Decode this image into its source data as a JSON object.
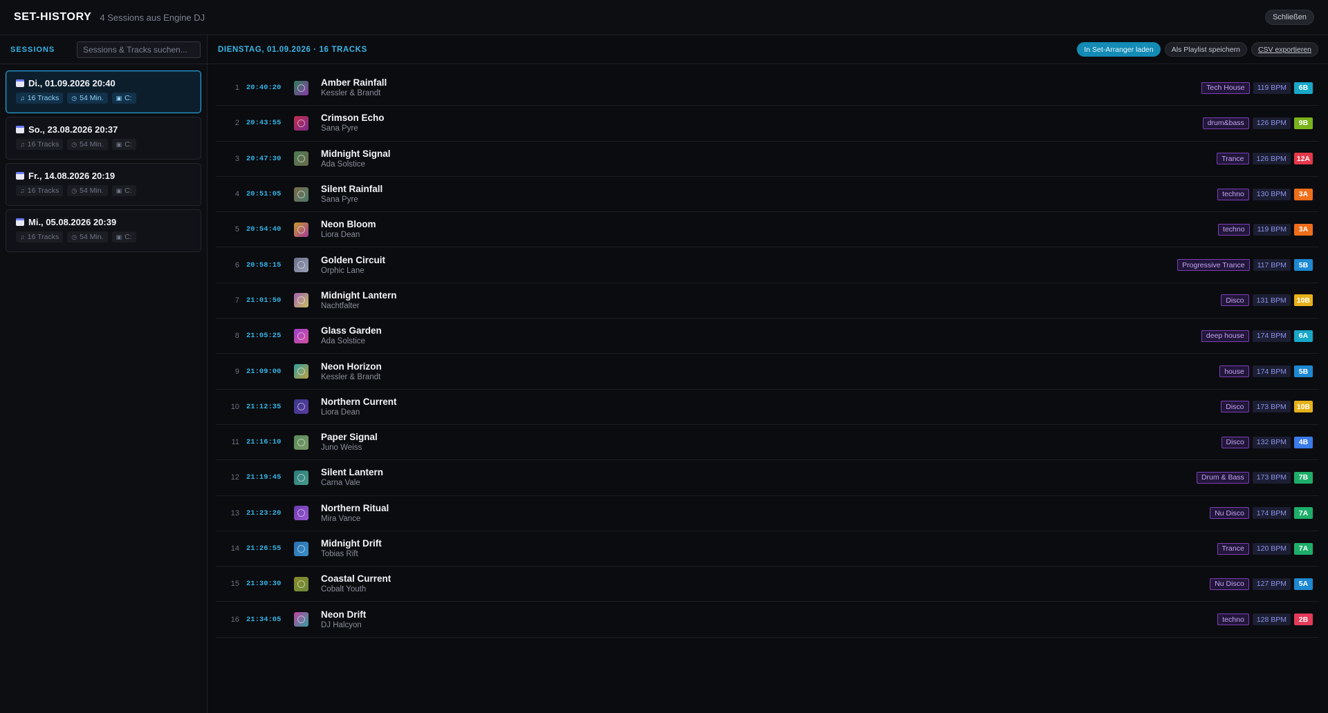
{
  "header": {
    "title": "SET-HISTORY",
    "subtitle": "4 Sessions aus Engine DJ",
    "close_label": "Schließen"
  },
  "sidebar": {
    "label": "SESSIONS",
    "search_placeholder": "Sessions & Tracks suchen...",
    "sessions": [
      {
        "title": "Di., 01.09.2026 20:40",
        "tracks": "16 Tracks",
        "duration": "54 Min.",
        "drive": "C:",
        "active": true
      },
      {
        "title": "So., 23.08.2026 20:37",
        "tracks": "16 Tracks",
        "duration": "54 Min.",
        "drive": "C:",
        "active": false
      },
      {
        "title": "Fr., 14.08.2026 20:19",
        "tracks": "16 Tracks",
        "duration": "54 Min.",
        "drive": "C:",
        "active": false
      },
      {
        "title": "Mi., 05.08.2026 20:39",
        "tracks": "16 Tracks",
        "duration": "54 Min.",
        "drive": "C:",
        "active": false
      }
    ]
  },
  "main": {
    "title": "DIENSTAG, 01.09.2026 · 16 TRACKS",
    "actions": {
      "load_arranger": "In Set-Arranger laden",
      "save_playlist": "Als Playlist speichern",
      "export_csv": "CSV exportieren"
    },
    "tracks": [
      {
        "num": "1",
        "time": "20:40:20",
        "title": "Amber Rainfall",
        "artist": "Kessler & Brandt",
        "genre": "Tech House",
        "bpm": "119 BPM",
        "key": "6B",
        "key_color": "#18a7c9",
        "art": [
          "#2e7d5c",
          "#8a3aa8"
        ]
      },
      {
        "num": "2",
        "time": "20:43:55",
        "title": "Crimson Echo",
        "artist": "Sana Pyre",
        "genre": "drum&bass",
        "bpm": "126 BPM",
        "key": "9B",
        "key_color": "#7ab21c",
        "art": [
          "#c22d4a",
          "#7a2a8c"
        ]
      },
      {
        "num": "3",
        "time": "20:47:30",
        "title": "Midnight Signal",
        "artist": "Ada Solstice",
        "genre": "Trance",
        "bpm": "126 BPM",
        "key": "12A",
        "key_color": "#e5384a",
        "art": [
          "#4a7a52",
          "#6a6a4a"
        ]
      },
      {
        "num": "4",
        "time": "20:51:05",
        "title": "Silent Rainfall",
        "artist": "Sana Pyre",
        "genre": "techno",
        "bpm": "130 BPM",
        "key": "3A",
        "key_color": "#ef6e1a",
        "art": [
          "#7a6a4a",
          "#4a7a6a"
        ]
      },
      {
        "num": "5",
        "time": "20:54:40",
        "title": "Neon Bloom",
        "artist": "Liora Dean",
        "genre": "techno",
        "bpm": "119 BPM",
        "key": "3A",
        "key_color": "#ef6e1a",
        "art": [
          "#c79b2a",
          "#a03a9a"
        ]
      },
      {
        "num": "6",
        "time": "20:58:15",
        "title": "Golden Circuit",
        "artist": "Orphic Lane",
        "genre": "Progressive Trance",
        "bpm": "117 BPM",
        "key": "5B",
        "key_color": "#1e88d2",
        "art": [
          "#6a6f8a",
          "#9aa0b5"
        ]
      },
      {
        "num": "7",
        "time": "21:01:50",
        "title": "Midnight Lantern",
        "artist": "Nachtfalter",
        "genre": "Disco",
        "bpm": "131 BPM",
        "key": "10B",
        "key_color": "#e6b21a",
        "art": [
          "#a060b0",
          "#c8c060"
        ]
      },
      {
        "num": "8",
        "time": "21:05:25",
        "title": "Glass Garden",
        "artist": "Ada Solstice",
        "genre": "deep house",
        "bpm": "174 BPM",
        "key": "6A",
        "key_color": "#18a7c9",
        "art": [
          "#a040c8",
          "#d050a0"
        ]
      },
      {
        "num": "9",
        "time": "21:09:00",
        "title": "Neon Horizon",
        "artist": "Kessler & Brandt",
        "genre": "house",
        "bpm": "174 BPM",
        "key": "5B",
        "key_color": "#1e88d2",
        "art": [
          "#30a0a0",
          "#c0a040"
        ]
      },
      {
        "num": "10",
        "time": "21:12:35",
        "title": "Northern Current",
        "artist": "Liora Dean",
        "genre": "Disco",
        "bpm": "173 BPM",
        "key": "10B",
        "key_color": "#e6b21a",
        "art": [
          "#3a3a8a",
          "#5a3aa0"
        ]
      },
      {
        "num": "11",
        "time": "21:16:10",
        "title": "Paper Signal",
        "artist": "Juno Weiss",
        "genre": "Disco",
        "bpm": "132 BPM",
        "key": "4B",
        "key_color": "#3a7be8",
        "art": [
          "#5a8a5a",
          "#7a9a6a"
        ]
      },
      {
        "num": "12",
        "time": "21:19:45",
        "title": "Silent Lantern",
        "artist": "Carna Vale",
        "genre": "Drum & Bass",
        "bpm": "173 BPM",
        "key": "7B",
        "key_color": "#1eae6a",
        "art": [
          "#2a7a7a",
          "#4a9a8a"
        ]
      },
      {
        "num": "13",
        "time": "21:23:20",
        "title": "Northern Ritual",
        "artist": "Mira Vance",
        "genre": "Nu Disco",
        "bpm": "174 BPM",
        "key": "7A",
        "key_color": "#1eae6a",
        "art": [
          "#6a3ab0",
          "#9a5ad0"
        ]
      },
      {
        "num": "14",
        "time": "21:26:55",
        "title": "Midnight Drift",
        "artist": "Tobias Rift",
        "genre": "Trance",
        "bpm": "120 BPM",
        "key": "7A",
        "key_color": "#1eae6a",
        "art": [
          "#2a70b0",
          "#3a90c8"
        ]
      },
      {
        "num": "15",
        "time": "21:30:30",
        "title": "Coastal Current",
        "artist": "Cobalt Youth",
        "genre": "Nu Disco",
        "bpm": "127 BPM",
        "key": "5A",
        "key_color": "#1e88d2",
        "art": [
          "#8a8a2a",
          "#6a8a3a"
        ]
      },
      {
        "num": "16",
        "time": "21:34:05",
        "title": "Neon Drift",
        "artist": "DJ Halcyon",
        "genre": "techno",
        "bpm": "128 BPM",
        "key": "2B",
        "key_color": "#e53a5a",
        "art": [
          "#c040a0",
          "#30a0a0"
        ]
      }
    ]
  }
}
